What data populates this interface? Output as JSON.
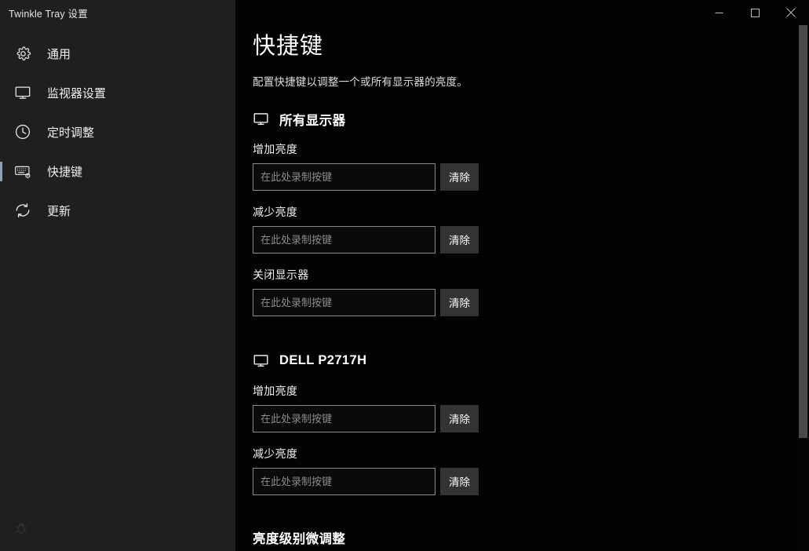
{
  "window": {
    "app_title": "Twinkle Tray 设置",
    "controls": [
      {
        "name": "minimize-button",
        "glyph": "minimize"
      },
      {
        "name": "maximize-button",
        "glyph": "maximize"
      },
      {
        "name": "close-button",
        "glyph": "close"
      }
    ]
  },
  "sidebar": {
    "items": [
      {
        "label": "通用",
        "icon": "gear-icon",
        "selected": false
      },
      {
        "label": "监视器设置",
        "icon": "monitor-icon",
        "selected": false
      },
      {
        "label": "定时调整",
        "icon": "clock-icon",
        "selected": false
      },
      {
        "label": "快捷键",
        "icon": "keyboard-gear-icon",
        "selected": true
      },
      {
        "label": "更新",
        "icon": "refresh-icon",
        "selected": false
      }
    ],
    "debug_icon": "bug-icon"
  },
  "main": {
    "title": "快捷键",
    "description": "配置快捷键以调整一个或所有显示器的亮度。",
    "sections": [
      {
        "icon": "monitor-icon",
        "title": "所有显示器",
        "fields": [
          {
            "label": "增加亮度",
            "value": "",
            "placeholder": "在此处录制按键",
            "clear_label": "清除"
          },
          {
            "label": "减少亮度",
            "value": "",
            "placeholder": "在此处录制按键",
            "clear_label": "清除"
          },
          {
            "label": "关闭显示器",
            "value": "",
            "placeholder": "在此处录制按键",
            "clear_label": "清除"
          }
        ]
      },
      {
        "icon": "monitor-icon",
        "title": "DELL P2717H",
        "fields": [
          {
            "label": "增加亮度",
            "value": "",
            "placeholder": "在此处录制按键",
            "clear_label": "清除"
          },
          {
            "label": "减少亮度",
            "value": "",
            "placeholder": "在此处录制按键",
            "clear_label": "清除"
          }
        ]
      }
    ],
    "cut_off_heading": "亮度级别微调整"
  },
  "colors": {
    "sidebar_bg": "#1f1f1f",
    "content_bg": "#030303",
    "accent_selected": "#8ea0b4",
    "input_border": "#8a8a8a",
    "button_bg": "#333333",
    "scroll_thumb": "#4a4a4a",
    "text_primary": "#ffffff",
    "text_placeholder": "#8b8b8b"
  }
}
